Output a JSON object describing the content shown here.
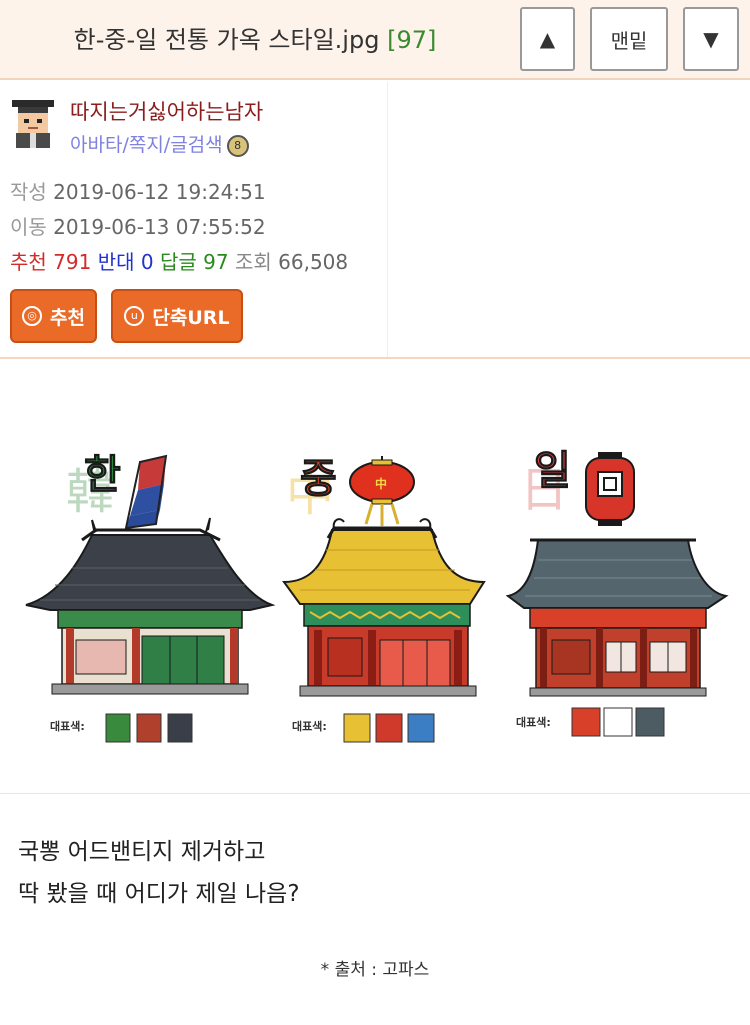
{
  "header": {
    "title": "한-중-일 전통 가옥 스타일.jpg",
    "comment_count": "[97]",
    "up_label": "▲",
    "bottom_label": "맨밑",
    "down_label": "▼"
  },
  "author": {
    "nickname": "따지는거싫어하는남자",
    "links": "아바타/쪽지/글검색",
    "badge_icon": "level-badge-icon"
  },
  "meta": {
    "written_label": "작성",
    "written_value": "2019-06-12 19:24:51",
    "moved_label": "이동",
    "moved_value": "2019-06-13 07:55:52"
  },
  "stats": {
    "recommend_label": "추천",
    "recommend_value": "791",
    "oppose_label": "반대",
    "oppose_value": "0",
    "reply_label": "답글",
    "reply_value": "97",
    "views_label": "조회",
    "views_value": "66,508"
  },
  "buttons": {
    "recommend": "추천",
    "short_url": "단축URL"
  },
  "illustration": {
    "korea_char": "한",
    "korea_hanja": "韓",
    "china_char": "중",
    "china_hanja": "中",
    "china_lantern_char": "中",
    "japan_char": "일",
    "japan_hanja": "日",
    "palette_label": "대표색:",
    "korea_colors": [
      "#3a8a3e",
      "#b0402c",
      "#3a3e48"
    ],
    "china_colors": [
      "#e8c033",
      "#cf3a2a",
      "#3c7ec4"
    ],
    "japan_colors": [
      "#d8402a",
      "#ffffff",
      "#4d5c63"
    ]
  },
  "content": {
    "line1": "국뽕 어드밴티지 제거하고",
    "line2": "딱 봤을 때 어디가 제일 나음?",
    "source": "* 출처 : 고파스"
  }
}
